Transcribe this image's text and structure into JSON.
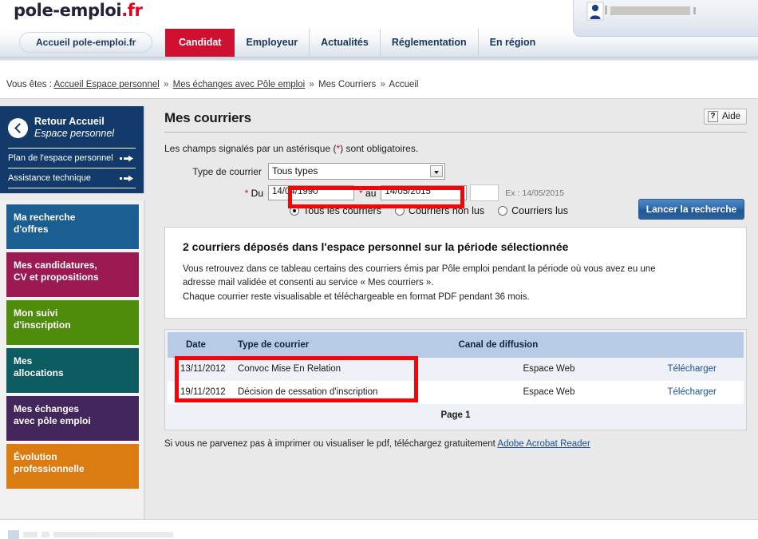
{
  "header": {
    "logo_text": "pole-emploi",
    "logo_suffix": ".fr",
    "home_tab": "Accueil pole-emploi.fr",
    "user_icon": "person-icon",
    "user_name_masked": "",
    "tabs": [
      {
        "label": "Candidat",
        "active": true
      },
      {
        "label": "Employeur",
        "active": false
      },
      {
        "label": "Actualités",
        "active": false
      },
      {
        "label": "Réglementation",
        "active": false
      },
      {
        "label": "En région",
        "active": false
      }
    ]
  },
  "breadcrumb": {
    "prefix": "Vous êtes :",
    "items": [
      {
        "label": "Accueil Espace personnel",
        "link": true
      },
      {
        "label": "Mes échanges avec Pôle emploi",
        "link": true
      },
      {
        "label": "Mes Courriers",
        "link": false
      },
      {
        "label": "Accueil",
        "link": false
      }
    ],
    "separator": "»"
  },
  "sidebar": {
    "back": {
      "icon": "chevron-left-icon",
      "line1": "Retour Accueil",
      "line2": "Espace personnel"
    },
    "links": [
      {
        "label": "Plan de l'espace personnel",
        "icon": "arrow-right-icon"
      },
      {
        "label": "Assistance technique",
        "icon": "arrow-right-icon"
      }
    ],
    "buttons": [
      {
        "label": "Ma recherche\nd'offres",
        "line1": "Ma recherche",
        "line2": "d'offres",
        "color": "#1b5f92"
      },
      {
        "label": "Mes candidatures, CV et propositions",
        "line1": "Mes candidatures,",
        "line2": "CV et propositions",
        "color": "#9c1a52"
      },
      {
        "label": "Mon suivi d'inscription",
        "line1": "Mon suivi",
        "line2": "d'inscription",
        "color": "#4f8c0b"
      },
      {
        "label": "Mes allocations",
        "line1": "Mes",
        "line2": "allocations",
        "color": "#0d5c62"
      },
      {
        "label": "Mes échanges avec pôle emploi",
        "line1": "Mes échanges",
        "line2": "avec pôle emploi",
        "color": "#43275c"
      },
      {
        "label": "Évolution professionnelle",
        "line1": "Évolution",
        "line2": "professionnelle",
        "color": "#da7c12"
      }
    ]
  },
  "content": {
    "page_title": "Mes courriers",
    "help_button": {
      "label": "Aide",
      "icon": "question-mark-icon"
    },
    "required_note_pre": "Les champs signalés par un astérisque (",
    "required_note_ast": "*",
    "required_note_post": ") sont obligatoires.",
    "form": {
      "type_label": "Type de courrier",
      "type_value": "Tous types",
      "type_options": [
        "Tous types"
      ],
      "du_label": "Du",
      "du_value": "14/04/1990",
      "au_label": "au",
      "au_value": "14/05/2015",
      "example_hint": "Ex : 14/05/2015",
      "radios": [
        {
          "label": "Tous les courriers",
          "checked": true
        },
        {
          "label": "Courriers non lus",
          "checked": false
        },
        {
          "label": "Courriers lus",
          "checked": false
        }
      ],
      "submit_label": "Lancer la recherche"
    },
    "info": {
      "title": "2 courriers déposés dans l'espace personnel sur la période sélectionnée",
      "line1": "Vous retrouvez dans ce tableau certains des courriers émis par Pôle emploi pendant la période où vous avez eu une",
      "line2": "adresse mail validée et consenti au service « Mes courriers ».",
      "line3": "Chaque courrier reste visualisable et téléchargeable en format PDF pendant 36 mois."
    },
    "table": {
      "columns": [
        "Date",
        "Type de courrier",
        "Canal de diffusion",
        ""
      ],
      "rows": [
        {
          "date": "13/11/2012",
          "type": "Convoc Mise En Relation",
          "canal": "Espace Web",
          "action": "Télécharger"
        },
        {
          "date": "19/11/2012",
          "type": "Décision de cessation d'inscription",
          "canal": "Espace Web",
          "action": "Télécharger"
        }
      ],
      "pagination": "Page 1"
    },
    "footer_note_pre": "Si vous ne parvenez pas à imprimer ou visualiser le pdf, téléchargez gratuitement ",
    "footer_note_link": "Adobe Acrobat Reader"
  },
  "annotations": {
    "color": "#fb0007",
    "boxes": [
      "date-range-fields",
      "table-first-two-rows"
    ]
  }
}
